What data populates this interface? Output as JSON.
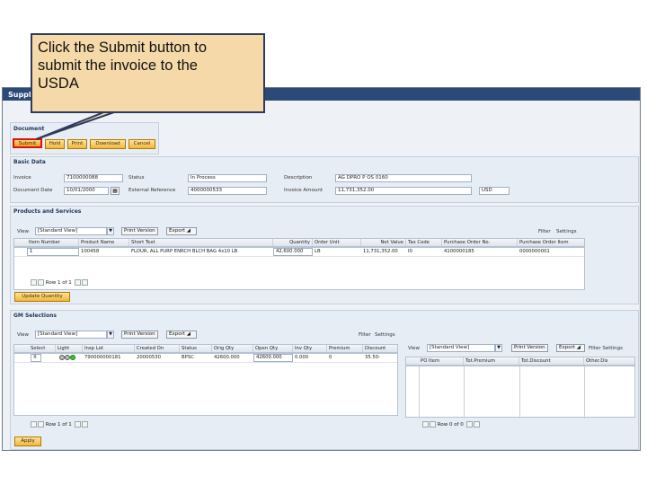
{
  "callout": {
    "line1": "Click the Submit button to",
    "line2": "submit the invoice to the",
    "line3": "USDA"
  },
  "window": {
    "title": "Supplie"
  },
  "document": {
    "section_title": "Document",
    "buttons": [
      "Submit",
      "Hold",
      "Print",
      "Download",
      "Cancel"
    ]
  },
  "basic_data": {
    "section_title": "Basic Data",
    "invoice_label": "Invoice",
    "invoice_value": "7100000088",
    "status_label": "Status",
    "status_value": "In Process",
    "description_label": "Description",
    "description_value": "AG DPRO P OS 0160",
    "doc_date_label": "Document Date",
    "doc_date_value": "10/01/2000",
    "ext_ref_label": "External Reference",
    "ext_ref_value": "4000000533",
    "inv_amount_label": "Invoice Amount",
    "inv_amount_value": "11,731,352.00",
    "currency_value": "USD"
  },
  "products": {
    "section_title": "Products and Services",
    "view_label": "View",
    "view_value": "[Standard View]",
    "print_version": "Print Version",
    "export": "Export",
    "filter": "Filter",
    "settings": "Settings",
    "columns": [
      "Item Number",
      "Product Name",
      "Short Text",
      "Quantity",
      "Order Unit",
      "Net Value",
      "Tax Code",
      "Purchase Order No.",
      "Purchase Order Item"
    ],
    "row": [
      "1",
      "100458",
      "FLOUR, ALL PURP ENRCH BLCH BAG 4x10 LB",
      "42,600.000",
      "LB",
      "11,731,352.00",
      "I0",
      "4100000185",
      "0000000001"
    ],
    "pager_row": "Row",
    "pager_value": "1",
    "pager_of": "of 1",
    "update_button": "Update Quantity"
  },
  "gm": {
    "section_title": "GM Selections",
    "view_label": "View",
    "view_value": "[Standard View]",
    "print_version": "Print Version",
    "export": "Export",
    "filter": "Filter",
    "settings": "Settings",
    "columns": [
      "Select",
      "Light",
      "Insp Lot",
      "Created On",
      "Status",
      "Orig Qty",
      "Open Qty",
      "Inv Qty",
      "Premium",
      "Discount"
    ],
    "row": [
      "X",
      "",
      "790000000181",
      "20000530",
      "BPSC",
      "42600.000",
      "42600.000",
      "0.000",
      "0",
      "35.50-"
    ],
    "pager_row": "Row",
    "pager_value": "1",
    "pager_of": "of 1",
    "apply_button": "Apply"
  },
  "right_grid": {
    "view_label": "View",
    "view_value": "[Standard View]",
    "print_version": "Print Version",
    "export": "Export",
    "filter_settings": "Filter Settings",
    "columns": [
      "PO Item",
      "Tot.Premium",
      "Tot.Discount",
      "Other.Dis"
    ],
    "pager_row": "Row",
    "pager_value": "0",
    "pager_of": "of 0"
  },
  "colors": {
    "accent": "#2b4a78",
    "button": "#f2b63c",
    "highlight": "#e01010",
    "callout_bg": "#f5d9a8"
  }
}
